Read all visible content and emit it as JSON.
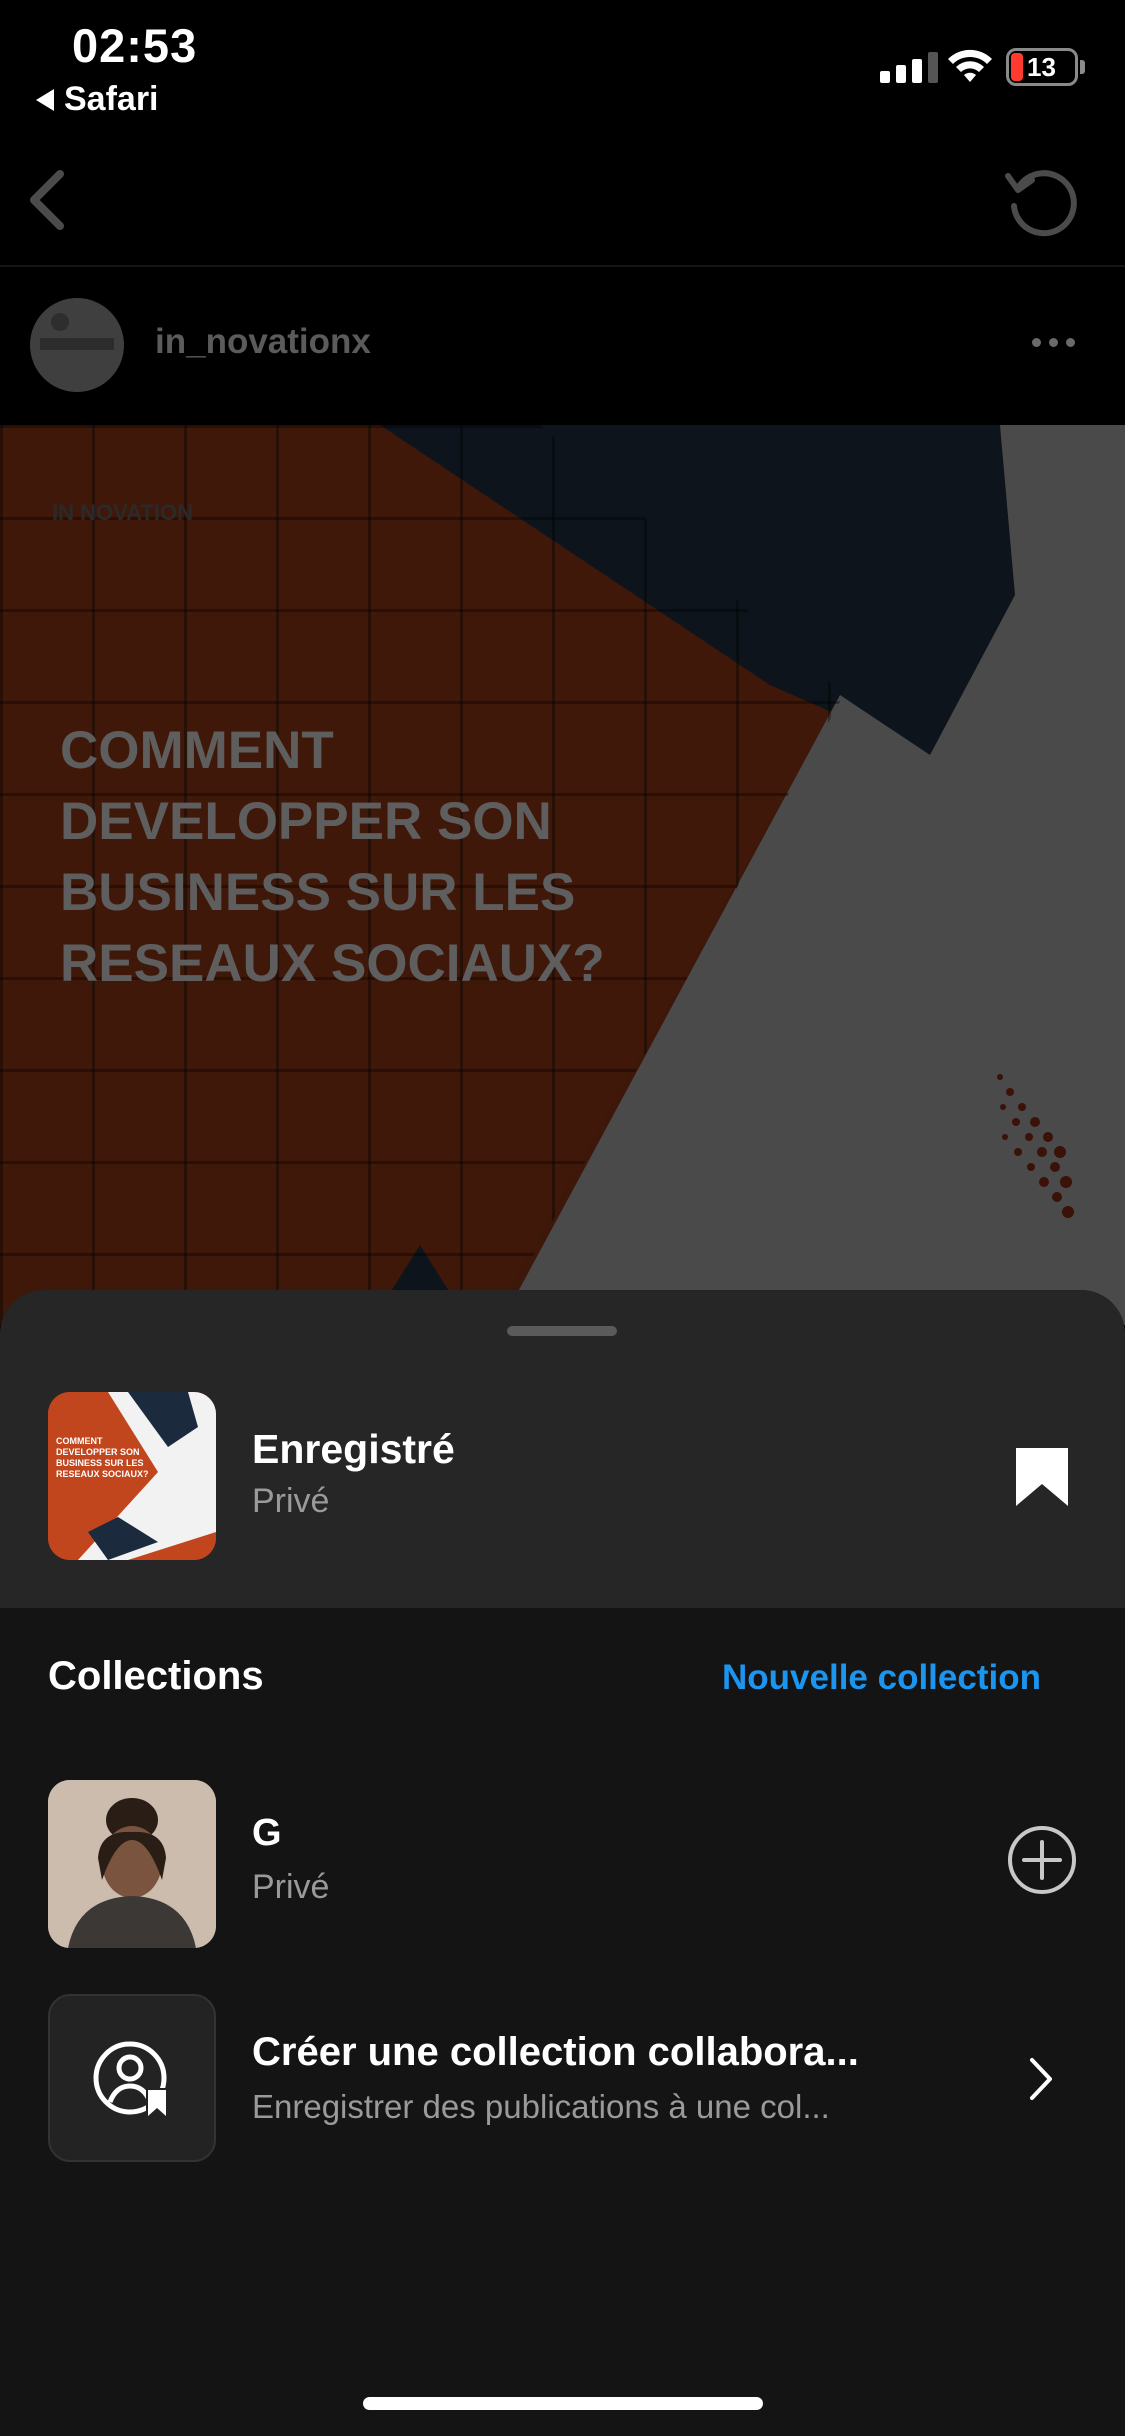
{
  "status_bar": {
    "time": "02:53",
    "back_app": "Safari",
    "battery": "13"
  },
  "post": {
    "username": "in_novationx",
    "logo_text": "IN NOVATION",
    "headline": "COMMENT\nDEVELOPPER SON\nBUSINESS SUR LES\nRESEAUX SOCIAUX?"
  },
  "sheet": {
    "saved": {
      "title": "Enregistré",
      "subtitle": "Privé",
      "thumb_text": "COMMENT\nDEVELOPPER SON\nBUSINESS SUR LES\nRESEAUX SOCIAUX?"
    },
    "collections_heading": "Collections",
    "new_collection": "Nouvelle collection",
    "items": [
      {
        "title": "G",
        "subtitle": "Privé"
      }
    ],
    "collab": {
      "title": "Créer une collection collabora...",
      "subtitle": "Enregistrer des publications à une col..."
    }
  },
  "colors": {
    "accent": "#1c95f0",
    "sheet_bg": "#141414",
    "sheet_top_bg": "#262626",
    "post_orange": "#b8451f",
    "post_navy": "#1b2a3d"
  }
}
